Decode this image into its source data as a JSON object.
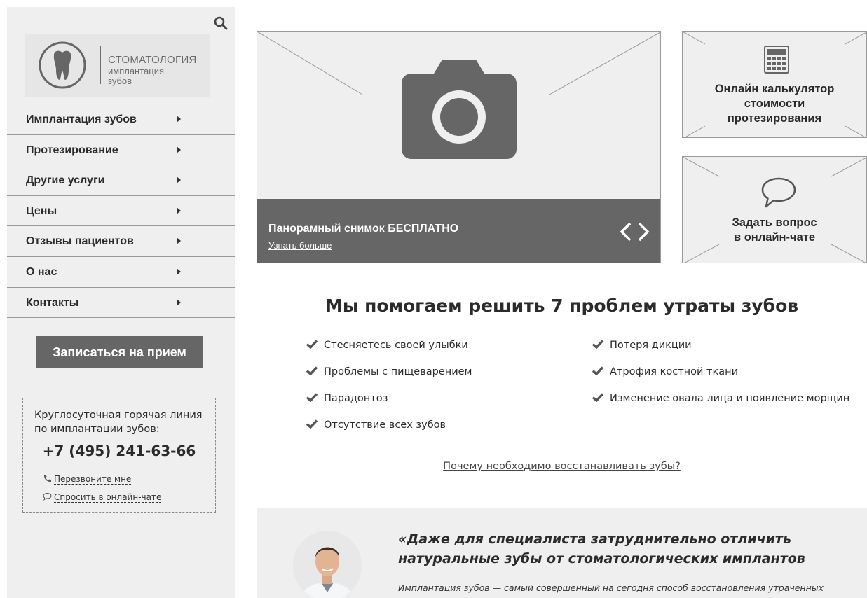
{
  "sidebar": {
    "logo": {
      "title": "СТОМАТОЛОГИЯ",
      "subtitle_line1": "имплантация",
      "subtitle_line2": "зубов"
    },
    "menu": [
      {
        "label": "Имплантация зубов"
      },
      {
        "label": "Протезирование"
      },
      {
        "label": "Другие услуги"
      },
      {
        "label": "Цены"
      },
      {
        "label": "Отзывы пациентов"
      },
      {
        "label": "О нас"
      },
      {
        "label": "Контакты"
      }
    ],
    "cta_label": "Записаться на прием",
    "hotline": {
      "text": "Круглосуточная горячая линия по имплантации зубов:",
      "phone": "+7 (495) 241-63-66",
      "callback_link": "Перезвоните мне",
      "chat_link": "Спросить в онлайн-чате"
    }
  },
  "slider": {
    "title": "Панорамный снимок БЕСПЛАТНО",
    "link": "Узнать больше"
  },
  "cards": [
    {
      "title_line1": "Онлайн калькулятор",
      "title_line2": "стоимости",
      "title_line3": "протезирования",
      "icon": "calculator-icon"
    },
    {
      "title_line1": "Задать вопрос",
      "title_line2": "в онлайн-чате",
      "icon": "chat-bubble-icon"
    }
  ],
  "problems": {
    "title": "Мы помогаем решить 7 проблем утраты зубов",
    "items": [
      "Стесняетесь своей улыбки",
      "Проблемы с пищеварением",
      "Парадонтоз",
      "Отсутствие всех зубов",
      "Потеря дикции",
      "Атрофия костной ткани",
      "Изменение овала лица и появление морщин"
    ],
    "why_link": "Почему необходимо восстанавливать зубы?"
  },
  "quote": {
    "title": "«Даже для специалиста затруднительно отличить натуральные зубы от стоматологических имплантов",
    "text": "Имплантация зубов — самый совершенный на сегодня способ восстановления утраченных"
  },
  "colors": {
    "panel": "#efefef",
    "dark": "#666666",
    "border": "#9a9a9a",
    "text": "#2b2b2b"
  }
}
